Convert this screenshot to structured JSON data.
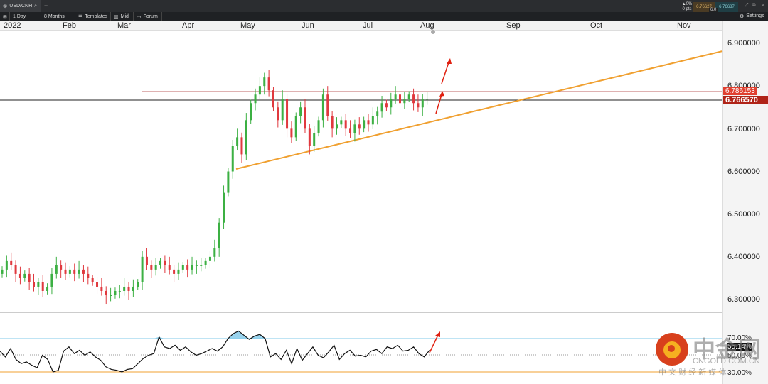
{
  "header": {
    "symbol": "USD/CNH",
    "add_tab": "+",
    "change_pct": "▲0%",
    "change_pts": "0 pts",
    "bid": "6.76627",
    "ask": "6.76687",
    "spread": "6.0",
    "settings_label": "Settings"
  },
  "toolbar": {
    "interval": "1 Day",
    "range": "8 Months",
    "templates": "Templates",
    "price_type": "Mid",
    "forum": "Forum"
  },
  "time_axis": [
    "2022",
    "Feb",
    "Mar",
    "Apr",
    "May",
    "Jun",
    "Jul",
    "Aug",
    "Sep",
    "Oct",
    "Nov"
  ],
  "price_axis": [
    "6.900000",
    "6.800000",
    "6.700000",
    "6.600000",
    "6.500000",
    "6.400000",
    "6.300000"
  ],
  "price_tags": {
    "line": "6.786153",
    "current": "6.766570"
  },
  "rsi_axis": {
    "upper": "70.00%",
    "mid": "50.00%",
    "lower": "30.00%",
    "current": "55.14%"
  },
  "colors": {
    "up": "#3cb043",
    "down": "#e0393e",
    "trendline": "#f0a030",
    "rsi_band": "#7fc8e8",
    "tag_red": "#c0281e"
  },
  "watermark": {
    "brand": "中金网",
    "domain": "CNGOLD.COM.CN",
    "tagline": "中 文 财 经 新 媒 体"
  },
  "closes": [
    6.37,
    6.39,
    6.38,
    6.36,
    6.35,
    6.36,
    6.34,
    6.33,
    6.34,
    6.32,
    6.33,
    6.36,
    6.38,
    6.37,
    6.36,
    6.37,
    6.36,
    6.37,
    6.36,
    6.35,
    6.34,
    6.33,
    6.32,
    6.31,
    6.31,
    6.32,
    6.32,
    6.33,
    6.32,
    6.33,
    6.34,
    6.4,
    6.38,
    6.37,
    6.38,
    6.39,
    6.38,
    6.37,
    6.36,
    6.37,
    6.38,
    6.37,
    6.38,
    6.38,
    6.38,
    6.39,
    6.4,
    6.42,
    6.48,
    6.55,
    6.6,
    6.66,
    6.68,
    6.64,
    6.72,
    6.76,
    6.78,
    6.8,
    6.82,
    6.79,
    6.75,
    6.72,
    6.77,
    6.7,
    6.68,
    6.73,
    6.75,
    6.7,
    6.66,
    6.69,
    6.72,
    6.78,
    6.73,
    6.7,
    6.71,
    6.72,
    6.7,
    6.69,
    6.71,
    6.7,
    6.72,
    6.71,
    6.73,
    6.74,
    6.76,
    6.75,
    6.77,
    6.78,
    6.76,
    6.77,
    6.78,
    6.76,
    6.75,
    6.77,
    6.77
  ],
  "rsi": [
    55,
    48,
    58,
    45,
    40,
    42,
    38,
    35,
    50,
    45,
    30,
    32,
    55,
    60,
    52,
    56,
    50,
    54,
    48,
    44,
    36,
    33,
    32,
    30,
    33,
    34,
    40,
    46,
    50,
    52,
    72,
    60,
    58,
    62,
    56,
    60,
    54,
    50,
    52,
    55,
    58,
    55,
    60,
    70,
    76,
    79,
    74,
    69,
    73,
    75,
    70,
    48,
    52,
    45,
    56,
    40,
    58,
    44,
    52,
    60,
    50,
    47,
    54,
    62,
    45,
    52,
    56,
    49,
    50,
    48,
    55,
    57,
    52,
    60,
    58,
    62,
    55,
    56,
    60,
    52,
    48,
    56
  ]
}
